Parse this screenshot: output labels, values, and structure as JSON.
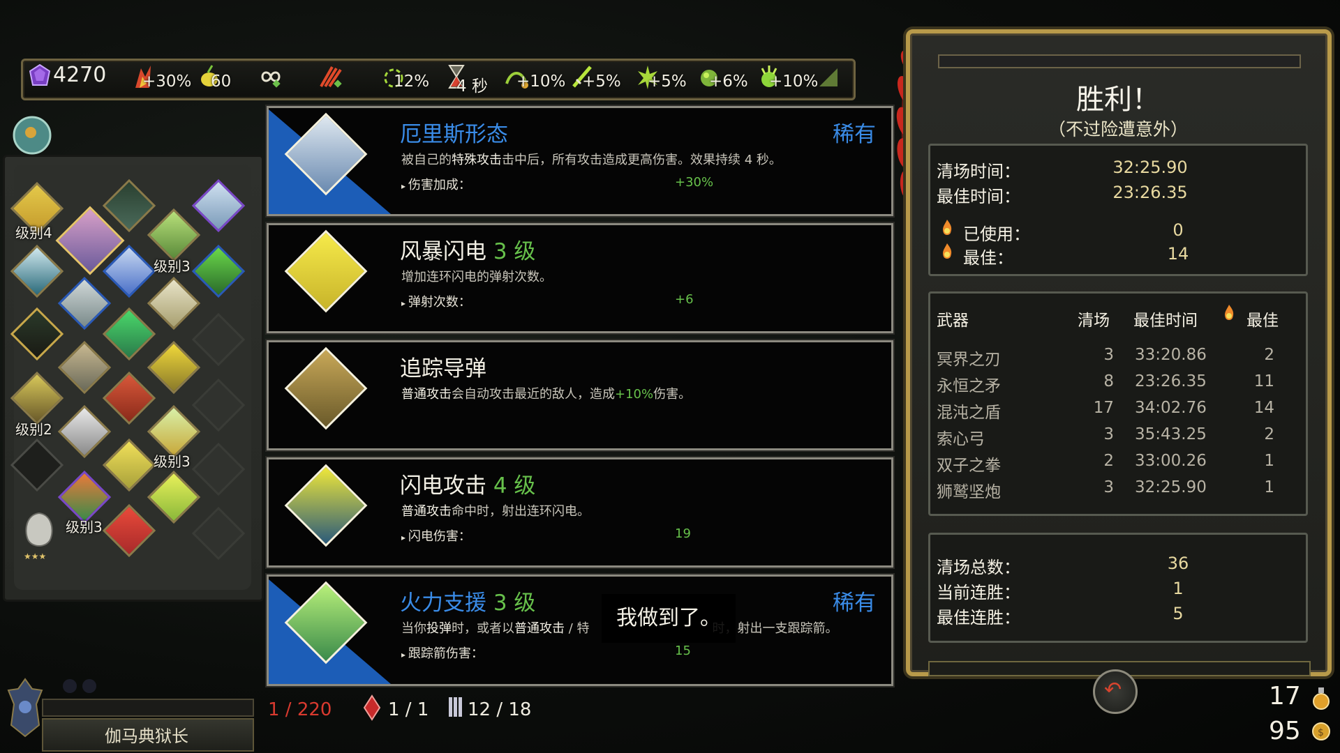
{
  "top_bar": {
    "gems": "4270",
    "stats": [
      "+30%",
      "60",
      "",
      "",
      "12%",
      "4 秒",
      "+10%",
      "+5%",
      "+5%",
      "+6%",
      "+10%",
      ""
    ]
  },
  "boon_grid": {
    "labels": [
      "级别4",
      "级别3",
      "级别2",
      "级别3",
      "级别3"
    ]
  },
  "boons": [
    {
      "title": "厄里斯形态",
      "level": "",
      "rarity": "稀有",
      "desc_pre": "被自己的",
      "desc_hl": "特殊攻击",
      "desc_post": "击中后，所有攻击造成更高伤害。效果持续 4 秒。",
      "stat_label": "伤害加成：",
      "stat_value": "+30%"
    },
    {
      "title": "风暴闪电",
      "level": "3 级",
      "rarity": "",
      "desc_pre": "增加连环闪电的弹射次数。",
      "desc_hl": "",
      "desc_post": "",
      "stat_label": "弹射次数：",
      "stat_value": "+6"
    },
    {
      "title": "追踪导弹",
      "level": "",
      "rarity": "",
      "desc_pre": "",
      "desc_hl": "普通攻击",
      "desc_post": "会自动攻击最近的敌人，造成",
      "desc_green": "+10%",
      "desc_end": "伤害。",
      "stat_label": "",
      "stat_value": ""
    },
    {
      "title": "闪电攻击",
      "level": "4 级",
      "rarity": "",
      "desc_pre": "",
      "desc_hl": "普通攻击",
      "desc_post": "命中时，射出连环闪电。",
      "stat_label": "闪电伤害：",
      "stat_value": "19"
    },
    {
      "title": "火力支援",
      "level": "3 级",
      "rarity": "稀有",
      "desc_pre": "当你",
      "desc_hl": "投弹",
      "desc_post": "时，或者以",
      "desc_hl2": "普通攻击",
      "desc_tail": " / 特",
      "desc_tail2": "时，射出一支跟踪箭。",
      "stat_label": "跟踪箭伤害：",
      "stat_value": "15"
    }
  ],
  "subtitle": "我做到了。",
  "bottom_left": {
    "boss_name": "伽马典狱长",
    "counter1": "1 / 220",
    "counter2": "1 / 1",
    "counter3": "12 / 18"
  },
  "results": {
    "title": "胜利！",
    "subtitle": "（不过险遭意外）",
    "clear_time_label": "清场时间：",
    "clear_time": "32:25.90",
    "best_time_label": "最佳时间：",
    "best_time": "23:26.35",
    "heat_used_label": "已使用：",
    "heat_used": "0",
    "heat_best_label": "最佳：",
    "heat_best": "14",
    "table_headers": [
      "武器",
      "清场",
      "最佳时间",
      "最佳"
    ],
    "weapons": [
      {
        "name": "冥界之刃",
        "clears": "3",
        "best_time": "33:20.86",
        "best": "2"
      },
      {
        "name": "永恒之矛",
        "clears": "8",
        "best_time": "23:26.35",
        "best": "11"
      },
      {
        "name": "混沌之盾",
        "clears": "17",
        "best_time": "34:02.76",
        "best": "14"
      },
      {
        "name": "索心弓",
        "clears": "3",
        "best_time": "35:43.25",
        "best": "2"
      },
      {
        "name": "双子之拳",
        "clears": "2",
        "best_time": "33:00.26",
        "best": "1"
      },
      {
        "name": "狮鹫坚炮",
        "clears": "3",
        "best_time": "32:25.90",
        "best": "1"
      }
    ],
    "total_clears_label": "清场总数：",
    "total_clears": "36",
    "current_streak_label": "当前连胜：",
    "current_streak": "1",
    "best_streak_label": "最佳连胜：",
    "best_streak": "5"
  },
  "currency": {
    "obols": "17",
    "keys": "95"
  },
  "colors": {
    "rare_blue": "#3a8ce8",
    "level_green": "#67c14b",
    "gold_frame": "#b89a4a"
  }
}
